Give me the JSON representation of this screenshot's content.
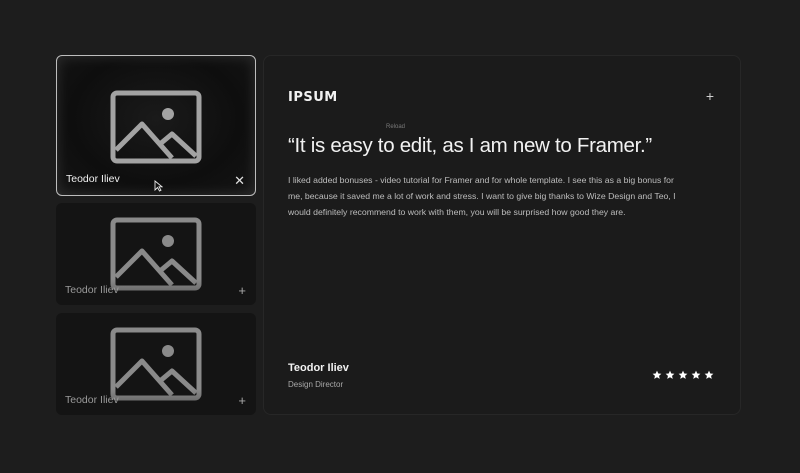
{
  "cards": [
    {
      "name": "Teodor Iliev",
      "action_icon": "close-icon",
      "action_label": "✕"
    },
    {
      "name": "Teodor Iliev",
      "action_icon": "plus-icon",
      "action_label": "+"
    },
    {
      "name": "Teodor Iliev",
      "action_icon": "plus-icon",
      "action_label": "+"
    }
  ],
  "testimonial": {
    "logo": "IPSUM",
    "reload_label": "Reload",
    "expand_label": "+",
    "quote": "“It is easy to edit, as I am new to Framer.”",
    "body": "I liked added bonuses - video tutorial for Framer and for whole template. I see this as a big bonus for me, because it saved me a lot of work and stress. I want to give big thanks to Wize Design and Teo, I would definitely recommend to work with them, you will be surprised how good they are.",
    "author_name": "Teodor Iliev",
    "author_role": "Design Director",
    "rating": 5
  },
  "colors": {
    "background": "#1d1d1d",
    "panel": "#1b1b1b",
    "active_border": "#bdbdbd",
    "star": "#ffffff"
  }
}
